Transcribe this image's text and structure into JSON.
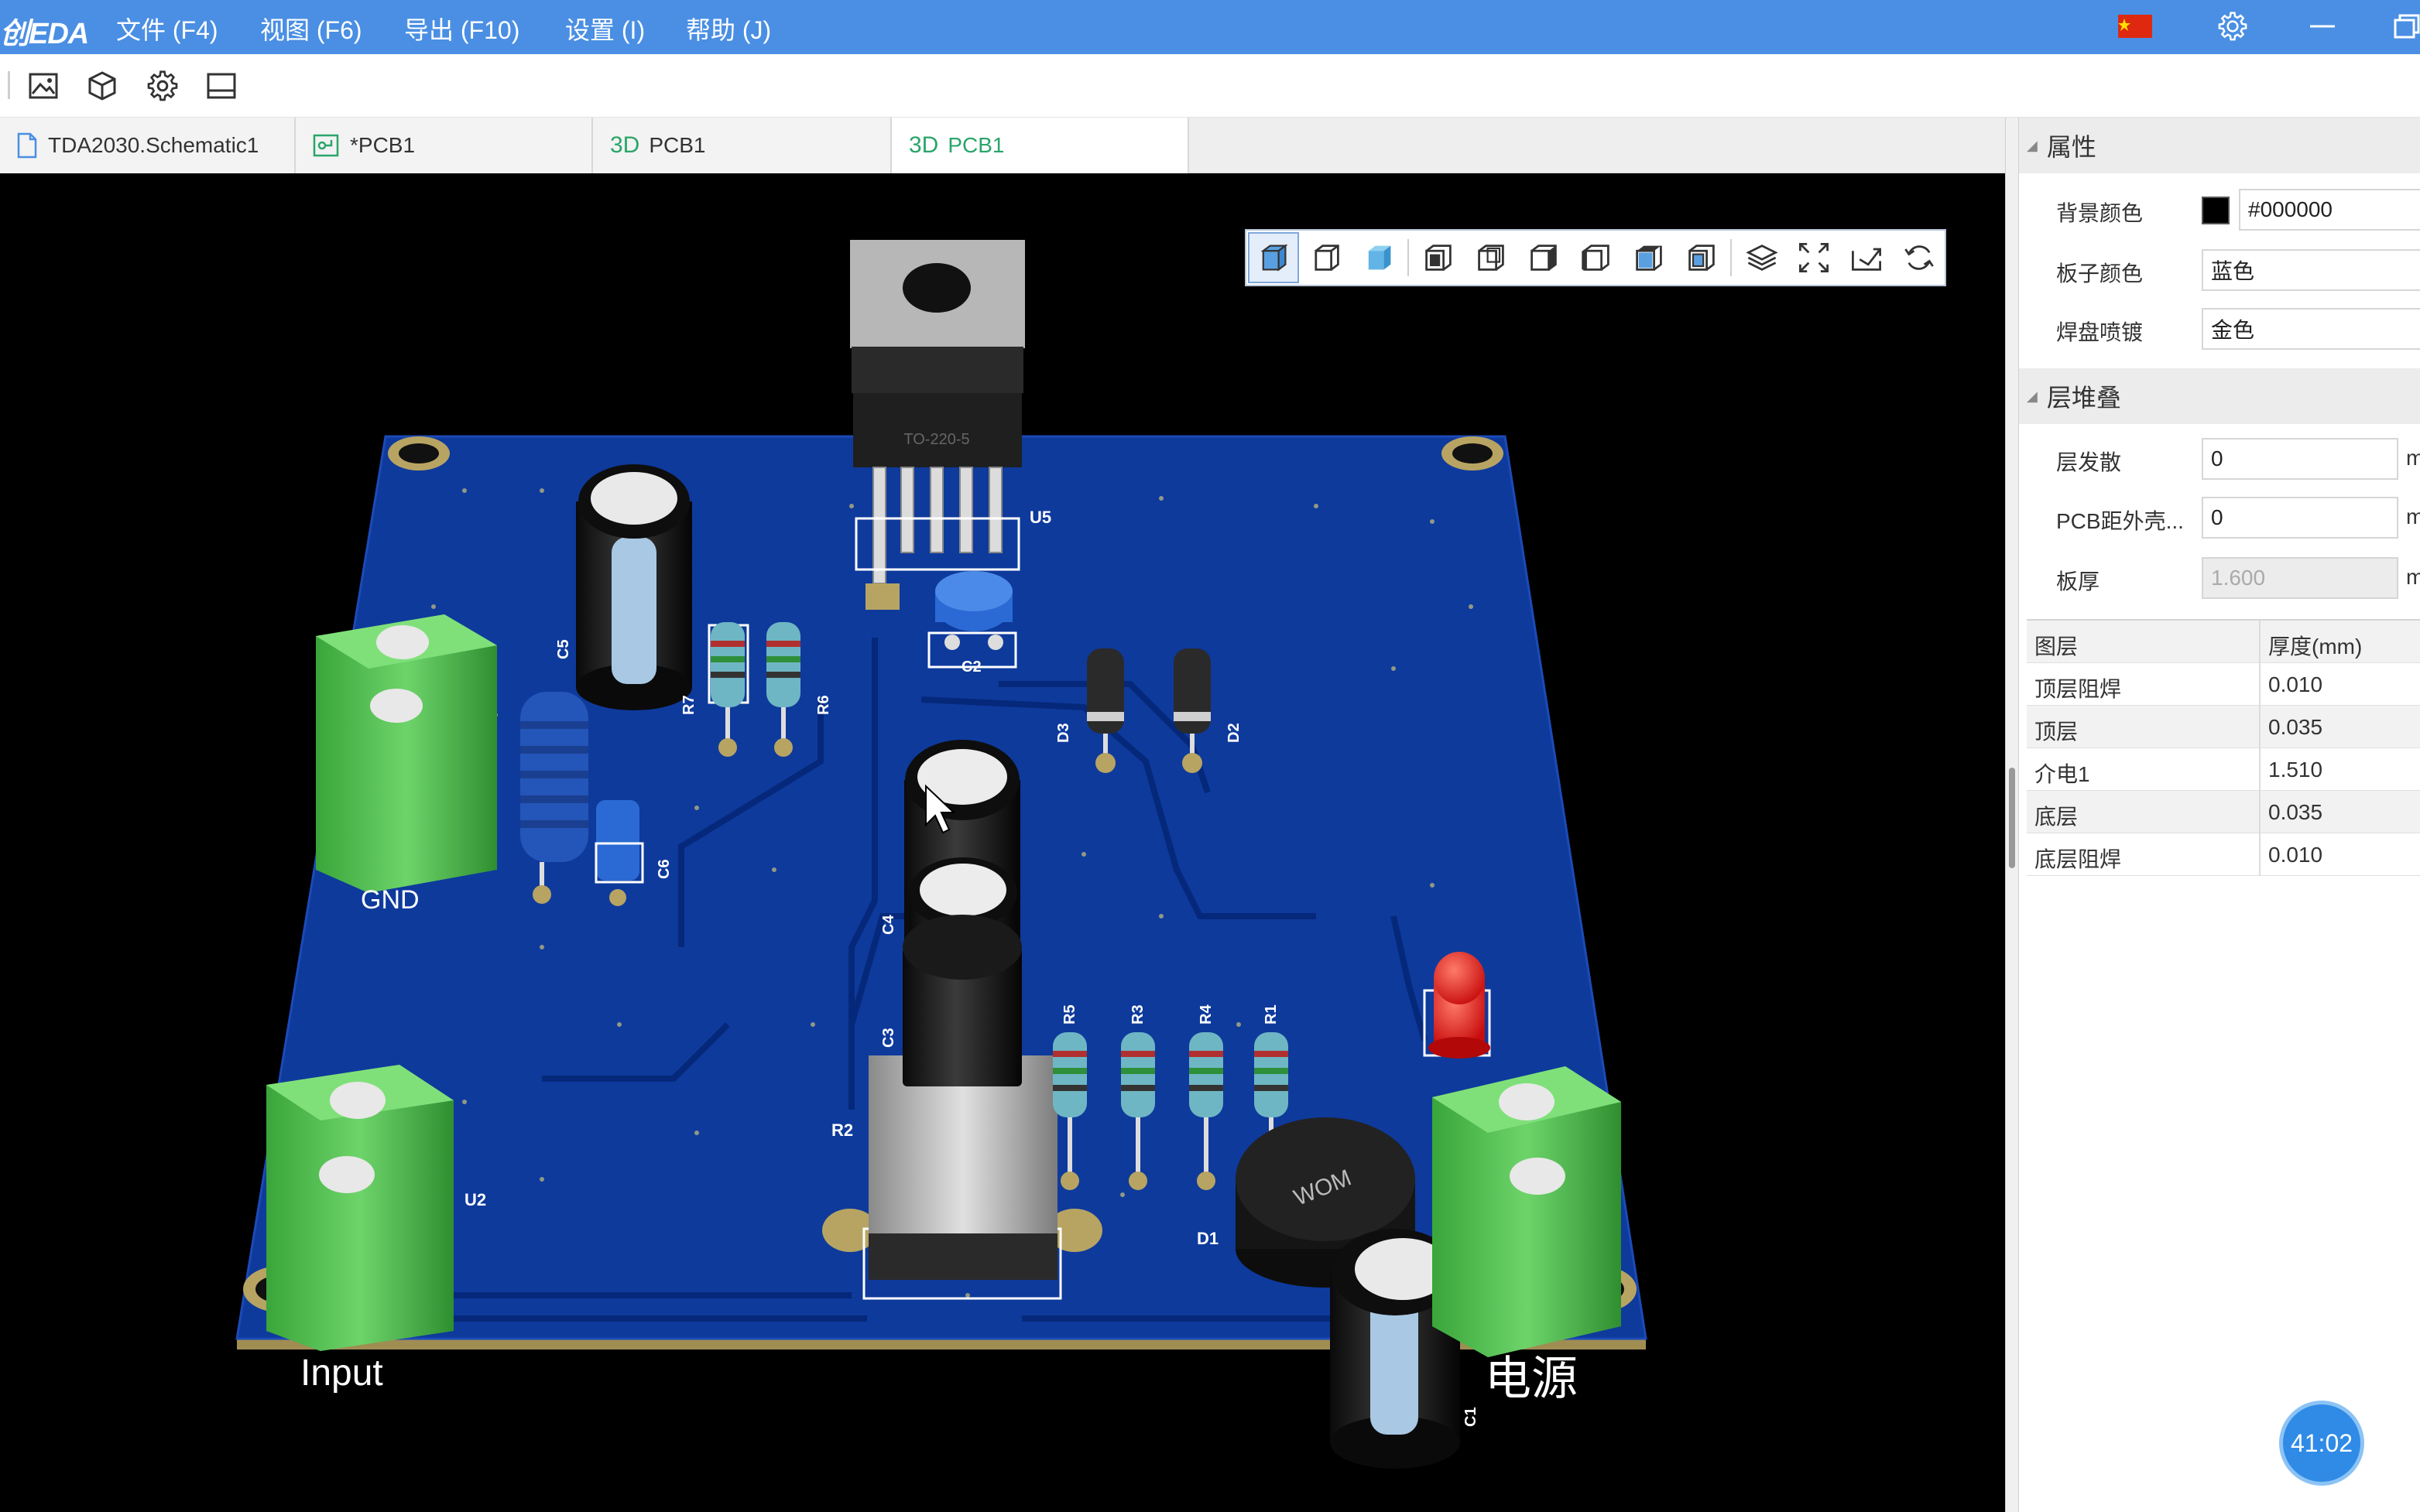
{
  "menubar": {
    "logo": "创EDA",
    "items": [
      "文件 (F4)",
      "视图 (F6)",
      "导出 (F10)",
      "设置 (I)",
      "帮助 (J)"
    ]
  },
  "tabs": [
    {
      "label": "TDA2030.Schematic1",
      "icon": "schematic-file-icon"
    },
    {
      "label": "*PCB1",
      "icon": "pcb-file-icon"
    },
    {
      "prefix": "3D",
      "label": "PCB1"
    },
    {
      "prefix": "3D",
      "label": "PCB1"
    }
  ],
  "panel": {
    "properties_title": "属性",
    "bg_color_label": "背景颜色",
    "bg_color_value": "#000000",
    "board_color_label": "板子颜色",
    "board_color_value": "蓝色",
    "pad_plating_label": "焊盘喷镀",
    "pad_plating_value": "金色",
    "stackup_title": "层堆叠",
    "layer_spread_label": "层发散",
    "layer_spread_value": "0",
    "layer_spread_unit": "m",
    "pcb_shell_label": "PCB距外壳...",
    "pcb_shell_value": "0",
    "pcb_shell_unit": "m",
    "thickness_label": "板厚",
    "thickness_value": "1.600",
    "thickness_unit": "m",
    "table_headers": [
      "图层",
      "厚度(mm)"
    ],
    "layers": [
      {
        "name": "顶层阻焊",
        "thickness": "0.010"
      },
      {
        "name": "顶层",
        "thickness": "0.035"
      },
      {
        "name": "介电1",
        "thickness": "1.510"
      },
      {
        "name": "底层",
        "thickness": "0.035"
      },
      {
        "name": "底层阻焊",
        "thickness": "0.010"
      }
    ]
  },
  "board_labels": {
    "u5": "U5",
    "c2": "C2",
    "c5": "C5",
    "r7": "R7",
    "r6": "R6",
    "d3": "D3",
    "d2": "D2",
    "gnd": "GND",
    "c6": "C6",
    "c4": "C4",
    "c3": "C3",
    "r5": "R5",
    "r3": "R3",
    "r4": "R4",
    "r1": "R1",
    "u2": "U2",
    "d1": "D1",
    "r2": "R2",
    "c1": "C1",
    "input": "Input",
    "power": "电源",
    "to220": "TO-220-5",
    "wom": "WOM"
  },
  "timer": "41:02",
  "colors": {
    "accent": "#4a8fe3",
    "active_tab_text": "#2aa56a",
    "board": "#0e3a9c",
    "background": "#000000"
  }
}
